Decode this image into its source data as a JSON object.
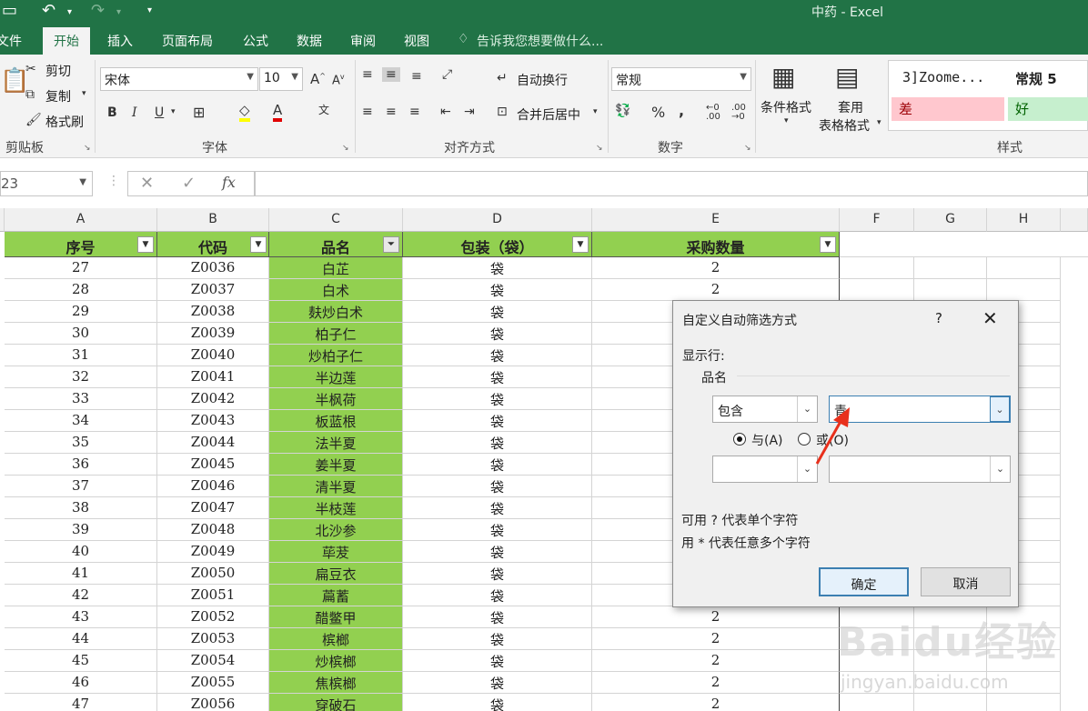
{
  "window": {
    "title": "中药 - Excel"
  },
  "tabs": [
    {
      "label": "文件"
    },
    {
      "label": "开始"
    },
    {
      "label": "插入"
    },
    {
      "label": "页面布局"
    },
    {
      "label": "公式"
    },
    {
      "label": "数据"
    },
    {
      "label": "审阅"
    },
    {
      "label": "视图"
    }
  ],
  "tell_me": "告诉我您想要做什么...",
  "ribbon": {
    "clipboard": {
      "paste": "粘贴",
      "cut": "剪切",
      "copy": "复制",
      "format_painter": "格式刷",
      "label": "剪贴板"
    },
    "font": {
      "name": "宋体",
      "size": "10",
      "label": "字体"
    },
    "alignment": {
      "wrap": "自动换行",
      "merge": "合并后居中",
      "label": "对齐方式"
    },
    "number": {
      "format": "常规",
      "label": "数字"
    },
    "styles": {
      "conditional": "条件格式",
      "table_fmt_1": "套用",
      "table_fmt_2": "表格格式",
      "zoom_style": "3]Zoome...",
      "normal5": "常规 5",
      "bad": "差",
      "good": "好",
      "label": "样式"
    }
  },
  "formula_bar": {
    "name_box": "23",
    "fx": "fx"
  },
  "columns": [
    "A",
    "B",
    "C",
    "D",
    "E",
    "F",
    "G",
    "H"
  ],
  "headers": [
    "序号",
    "代码",
    "品名",
    "包装（袋）",
    "采购数量"
  ],
  "rows": [
    {
      "n": "27",
      "code": "Z0036",
      "name": "白芷",
      "pack": "袋",
      "qty": "2"
    },
    {
      "n": "28",
      "code": "Z0037",
      "name": "白术",
      "pack": "袋",
      "qty": "2"
    },
    {
      "n": "29",
      "code": "Z0038",
      "name": "麸炒白术",
      "pack": "袋",
      "qty": ""
    },
    {
      "n": "30",
      "code": "Z0039",
      "name": "柏子仁",
      "pack": "袋",
      "qty": ""
    },
    {
      "n": "31",
      "code": "Z0040",
      "name": "炒柏子仁",
      "pack": "袋",
      "qty": ""
    },
    {
      "n": "32",
      "code": "Z0041",
      "name": "半边莲",
      "pack": "袋",
      "qty": ""
    },
    {
      "n": "33",
      "code": "Z0042",
      "name": "半枫荷",
      "pack": "袋",
      "qty": ""
    },
    {
      "n": "34",
      "code": "Z0043",
      "name": "板蓝根",
      "pack": "袋",
      "qty": ""
    },
    {
      "n": "35",
      "code": "Z0044",
      "name": "法半夏",
      "pack": "袋",
      "qty": ""
    },
    {
      "n": "36",
      "code": "Z0045",
      "name": "姜半夏",
      "pack": "袋",
      "qty": ""
    },
    {
      "n": "37",
      "code": "Z0046",
      "name": "清半夏",
      "pack": "袋",
      "qty": ""
    },
    {
      "n": "38",
      "code": "Z0047",
      "name": "半枝莲",
      "pack": "袋",
      "qty": ""
    },
    {
      "n": "39",
      "code": "Z0048",
      "name": "北沙参",
      "pack": "袋",
      "qty": ""
    },
    {
      "n": "40",
      "code": "Z0049",
      "name": "荜茇",
      "pack": "袋",
      "qty": ""
    },
    {
      "n": "41",
      "code": "Z0050",
      "name": "扁豆衣",
      "pack": "袋",
      "qty": ""
    },
    {
      "n": "42",
      "code": "Z0051",
      "name": "萹蓄",
      "pack": "袋",
      "qty": ""
    },
    {
      "n": "43",
      "code": "Z0052",
      "name": "醋鳖甲",
      "pack": "袋",
      "qty": "2"
    },
    {
      "n": "44",
      "code": "Z0053",
      "name": "槟榔",
      "pack": "袋",
      "qty": "2"
    },
    {
      "n": "45",
      "code": "Z0054",
      "name": "炒槟榔",
      "pack": "袋",
      "qty": "2"
    },
    {
      "n": "46",
      "code": "Z0055",
      "name": "焦槟榔",
      "pack": "袋",
      "qty": "2"
    },
    {
      "n": "47",
      "code": "Z0056",
      "name": "穿破石",
      "pack": "袋",
      "qty": "2"
    }
  ],
  "dialog": {
    "title": "自定义自动筛选方式",
    "help": "?",
    "show_rows": "显示行:",
    "field": "品名",
    "op1": "包含",
    "val1": "青",
    "and_label": "与(A)",
    "or_label": "或(O)",
    "op2": "",
    "val2": "",
    "hint1": "可用 ? 代表单个字符",
    "hint2": "用 * 代表任意多个字符",
    "ok": "确定",
    "cancel": "取消"
  },
  "watermark": {
    "brand": "Baidu经验",
    "url": "jingyan.baidu.com"
  },
  "colors": {
    "excel_green": "#217346",
    "header_green": "#92d050",
    "annotation_arrow": "#e8301c"
  }
}
